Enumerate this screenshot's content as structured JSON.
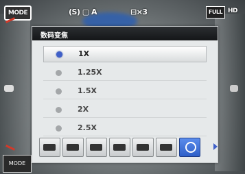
{
  "status": {
    "mode_label": "MODE",
    "flash_label": "(S) ▢ A",
    "timer_label": "⊟×3",
    "size_label": "FULL",
    "size_sub": "HD"
  },
  "menu": {
    "title": "数码变焦",
    "options": [
      {
        "label": "1X",
        "selected": true
      },
      {
        "label": "1.25X",
        "selected": false
      },
      {
        "label": "1.5X",
        "selected": false
      },
      {
        "label": "2X",
        "selected": false
      },
      {
        "label": "2.5X",
        "selected": false
      }
    ],
    "toolbar": [
      {
        "icon": "landscape-icon",
        "active": false
      },
      {
        "icon": "mountain-icon",
        "active": false
      },
      {
        "icon": "scene-icon",
        "active": false
      },
      {
        "icon": "building-icon",
        "active": false
      },
      {
        "icon": "macro-icon",
        "active": false
      },
      {
        "icon": "camera-icon",
        "active": false
      },
      {
        "icon": "zoom-icon",
        "active": true
      }
    ]
  },
  "bottom_left_label": "MODE",
  "colors": {
    "accent": "#4060c8",
    "header": "#141618"
  }
}
